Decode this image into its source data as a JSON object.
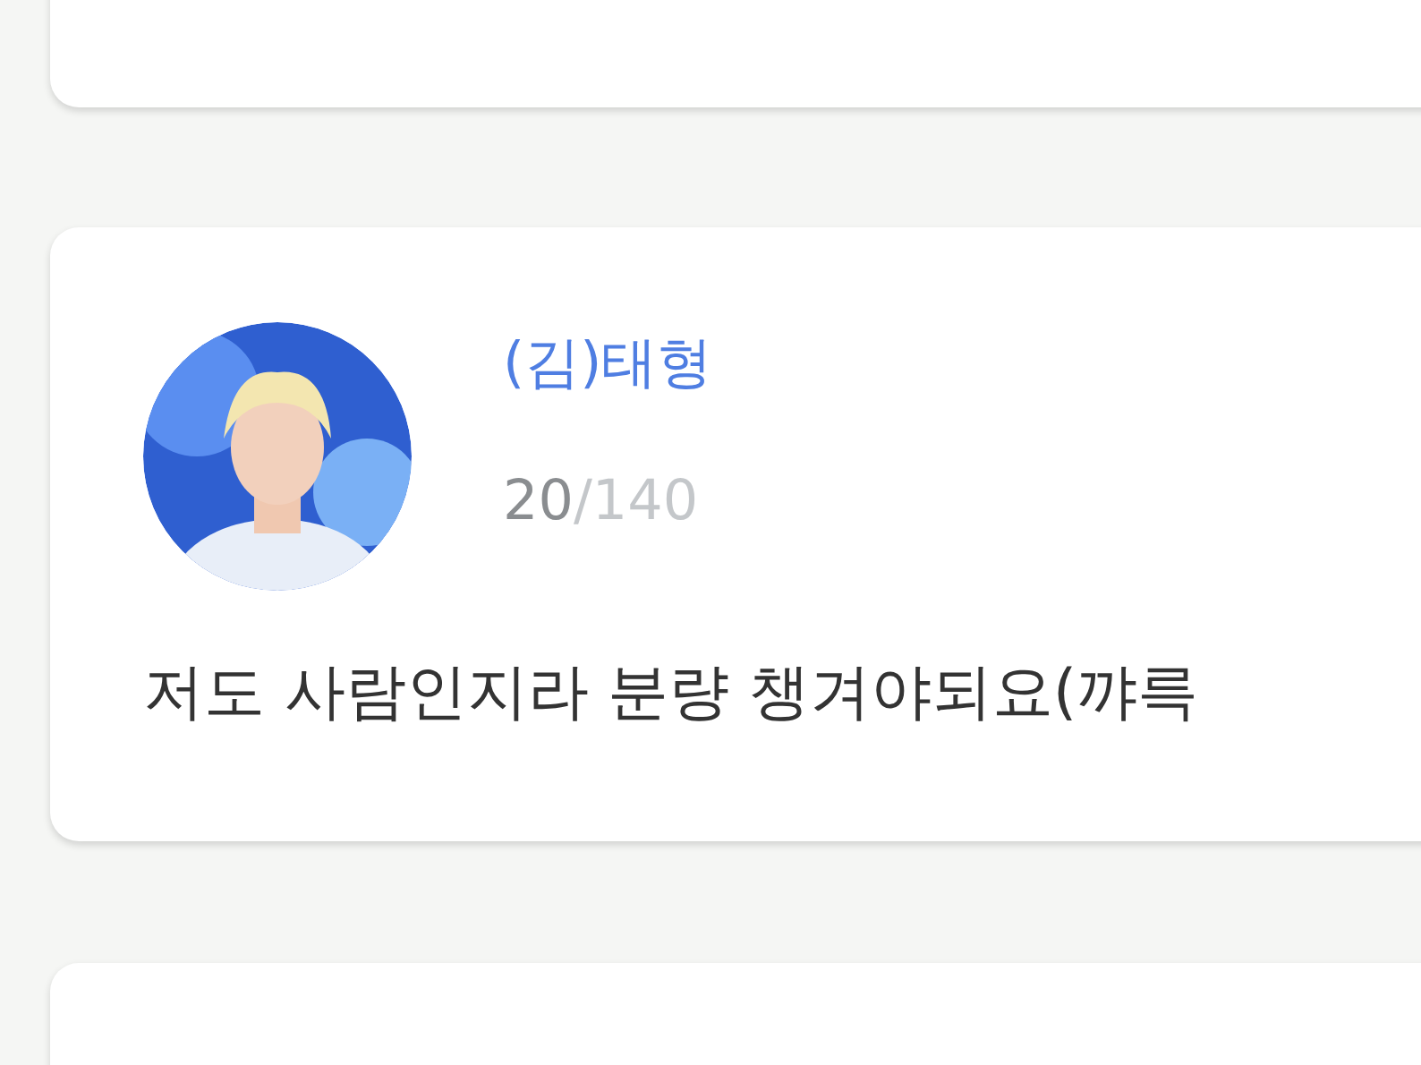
{
  "post": {
    "name": "(김)태형",
    "count": "20",
    "limit": "/140",
    "text": "저도 사람인지라 분량 챙겨야되요(꺄륵"
  }
}
